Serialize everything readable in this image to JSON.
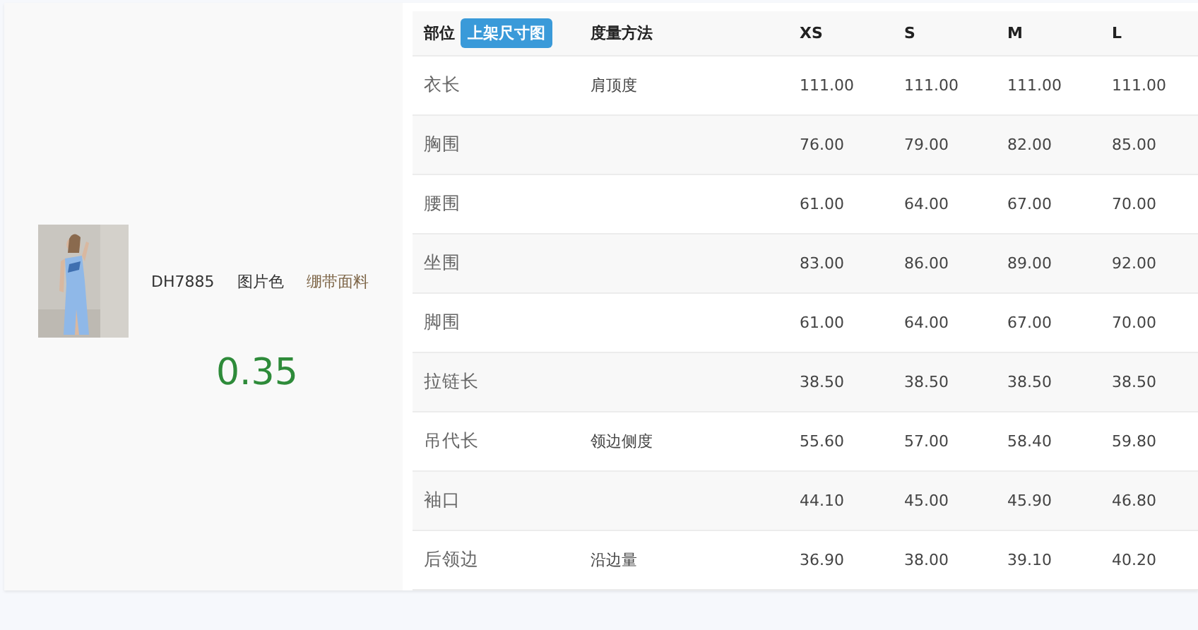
{
  "product": {
    "code": "DH7885",
    "color_name": "图片色",
    "fabric": "绷带面料",
    "price": "0.35"
  },
  "table": {
    "part_header": "部位",
    "upload_button": "上架尺寸图",
    "method_header": "度量方法",
    "sizes": [
      "XS",
      "S",
      "M",
      "L"
    ],
    "rows": [
      {
        "part": "衣长",
        "method": "肩顶度",
        "values": [
          "111.00",
          "111.00",
          "111.00",
          "111.00"
        ]
      },
      {
        "part": "胸围",
        "values": [
          "76.00",
          "79.00",
          "82.00",
          "85.00"
        ]
      },
      {
        "part": "腰围",
        "values": [
          "61.00",
          "64.00",
          "67.00",
          "70.00"
        ]
      },
      {
        "part": "坐围",
        "values": [
          "83.00",
          "86.00",
          "89.00",
          "92.00"
        ]
      },
      {
        "part": "脚围",
        "values": [
          "61.00",
          "64.00",
          "67.00",
          "70.00"
        ]
      },
      {
        "part": "拉链长",
        "values": [
          "38.50",
          "38.50",
          "38.50",
          "38.50"
        ]
      },
      {
        "part": "吊代长",
        "method": "领边侧度",
        "values": [
          "55.60",
          "57.00",
          "58.40",
          "59.80"
        ]
      },
      {
        "part": "袖口",
        "values": [
          "44.10",
          "45.00",
          "45.90",
          "46.80"
        ]
      },
      {
        "part": "后领边",
        "method": "沿边量",
        "values": [
          "36.90",
          "38.00",
          "39.10",
          "40.20"
        ]
      }
    ]
  }
}
